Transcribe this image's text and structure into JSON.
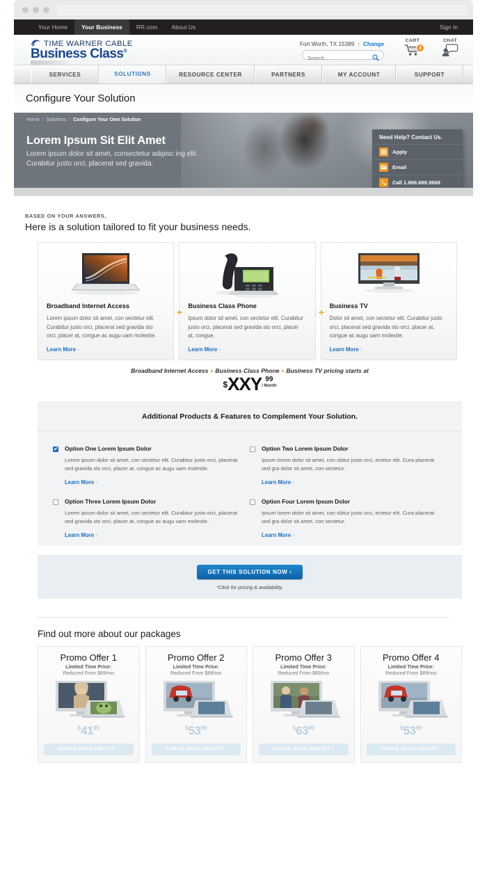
{
  "browser": {
    "url_placeholder": ""
  },
  "utility_nav": {
    "items": [
      {
        "label": "Your Home",
        "active": false
      },
      {
        "label": "Your Business",
        "active": true
      },
      {
        "label": "RR.com",
        "active": false
      },
      {
        "label": "About Us",
        "active": false
      }
    ],
    "sign_in": "Sign In"
  },
  "header": {
    "logo_top": "TIME WARNER CABLE",
    "logo_main": "Business Class",
    "logo_reg": "®",
    "location": "Fort Worth, TX 15389",
    "location_sep": "|",
    "change_label": "Change",
    "search_placeholder": "Search...",
    "search_value": "",
    "cart_label": "CART",
    "cart_count": "3",
    "chat_label": "CHAT"
  },
  "main_nav": {
    "items": [
      {
        "label": "SERVICES",
        "active": false,
        "width": 97
      },
      {
        "label": "SOLUTIONS",
        "active": true,
        "width": 97
      },
      {
        "label": "RESOURCE CENTER",
        "active": false,
        "width": 127
      },
      {
        "label": "PARTNERS",
        "active": false,
        "width": 97
      },
      {
        "label": "MY ACCOUNT",
        "active": false,
        "width": 106
      },
      {
        "label": "SUPPORT",
        "active": false,
        "width": 97
      }
    ]
  },
  "page": {
    "title": "Configure Your Solution"
  },
  "hero": {
    "breadcrumb": [
      {
        "label": "Home",
        "current": false
      },
      {
        "label": "Solutions",
        "current": false
      },
      {
        "label": "Configure Your Own Solution",
        "current": true
      }
    ],
    "heading": "Lorem Ipsum Sit Elit Amet",
    "paragraph": "Lorem ipsum dolor sit amet, consectetur adipisc ing elit. Curabitur justo orci, placerat sed gravida.",
    "help": {
      "title": "Need Help? Contact Us.",
      "rows": [
        {
          "label": "Apply",
          "icon": "list-icon"
        },
        {
          "label": "Email",
          "icon": "envelope-icon"
        },
        {
          "label": "Call 1.866.689.3668",
          "icon": "phone-icon"
        }
      ]
    }
  },
  "solution": {
    "eyebrow": "BASED ON YOUR ANSWERS,",
    "lead": "Here is a solution tailored to fit your business needs.",
    "learn_more": "Learn More",
    "chevron": "›",
    "cards": [
      {
        "title": "Broadband Internet Access",
        "body": "Lorem ipsum dolor sit amet, con sectetur elit. Curabitur justo orci, placerat sed gravida sto orci, placer at, congue ac augu uam molestie.",
        "image": "laptop-image"
      },
      {
        "title": "Business Class Phone",
        "body": "Ipsum dolor sit amet, con sectetur elit. Curabitur justo orci, placerat sed gravida sto orci, placer at, congue.",
        "image": "desk-phone-image"
      },
      {
        "title": "Business TV",
        "body": "Dolor sit amet, con sectetur elit. Curabitur justo orci, placerat sed gravida sto orci, placer at, congue ac augu uam molestie.",
        "image": "television-image"
      }
    ],
    "price": {
      "prefix": "Broadband Internet Access",
      "plus1": "+",
      "mid": "Business Class Phone",
      "plus2": "+",
      "suffix": "Business TV pricing starts at",
      "dollar": "$",
      "amount": "XXY",
      "cents": "99",
      "period": "/ Month"
    }
  },
  "additional": {
    "heading": "Additional Products & Features to Complement Your Solution.",
    "learn_more": "Learn More",
    "chevron": "›",
    "options": [
      {
        "title": "Option One Lorem Ipsum Dolor",
        "body": "Lorem ipsum dolor sit amet, con sectetur elit. Curabitur justo orci, placerat sed gravida sto orci, placer at, congue ac augu uam molestie.",
        "checked": true
      },
      {
        "title": "Option Two Lorem Ipsum Dolor",
        "body": "Ipsum lorem dolor sit amet, con sbitur justo orci, ectetur elit. Cura placerat sed gra  dolor sit amet, con sectetur.",
        "checked": false
      },
      {
        "title": "Option Three Lorem Ipsum Dolor",
        "body": "Lorem ipsum dolor sit amet, con sectetur elit. Curabitur justo orci, placerat sed gravida sto orci, placer at, congue ac augu uam molestie.",
        "checked": false
      },
      {
        "title": "Option Four Lorem Ipsum Dolor",
        "body": "Ipsum lorem dolor sit amet, con sbitur justo orci, ectetur elit. Cura placerat sed gra  dolor sit amet, con sectetur.",
        "checked": false
      }
    ]
  },
  "cta": {
    "button_label": "GET THIS SOLUTION NOW",
    "button_chevron": "›",
    "note": "*Click for pricing & availability."
  },
  "packages": {
    "heading": "Find out more about our packages",
    "limited_label": "Limited Time Price:",
    "reduced_label": "Reduced From $89/mo",
    "button_label": "CHECK AVAILABILITY",
    "button_chevron": "›",
    "items": [
      {
        "title": "Promo Offer 1",
        "dollar": "$",
        "price": "41",
        "cents": "99",
        "image": "tv-laptop-image"
      },
      {
        "title": "Promo Offer 2",
        "dollar": "$",
        "price": "53",
        "cents": "99",
        "image": "tv-laptop-image"
      },
      {
        "title": "Promo Offer 3",
        "dollar": "$",
        "price": "63",
        "cents": "99",
        "image": "tv-laptop-image"
      },
      {
        "title": "Promo Offer 4",
        "dollar": "$",
        "price": "53",
        "cents": "99",
        "image": "tv-laptop-image"
      }
    ]
  },
  "colors": {
    "brand_blue": "#15488f",
    "link_blue": "#1b6fc0",
    "accent_orange": "#f0961e",
    "nav_active": "#2b7dc4",
    "hero_bg": "#6f757c"
  }
}
